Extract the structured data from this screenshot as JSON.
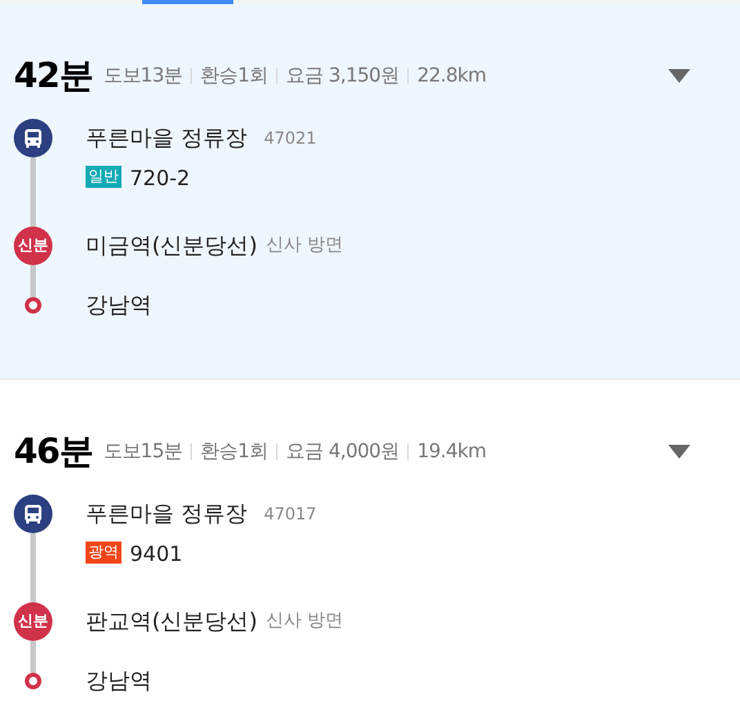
{
  "routes": [
    {
      "selected": true,
      "duration": "42분",
      "meta": [
        "도보13분",
        "환승1회",
        "요금 3,150원",
        "22.8km"
      ],
      "stops": [
        {
          "kind": "bus",
          "name": "푸른마을 정류장",
          "stop_id": "47021",
          "bus_type": "일반",
          "color": "#12aab5",
          "bus_number": "720-2"
        },
        {
          "kind": "subway",
          "badge": "신분",
          "name": "미금역(신분당선)",
          "direction": "신사 방면"
        },
        {
          "kind": "end",
          "name": "강남역"
        }
      ]
    },
    {
      "selected": false,
      "duration": "46분",
      "meta": [
        "도보15분",
        "환승1회",
        "요금 4,000원",
        "19.4km"
      ],
      "stops": [
        {
          "kind": "bus",
          "name": "푸른마을 정류장",
          "stop_id": "47017",
          "bus_type": "광역",
          "color": "#f2461a",
          "bus_number": "9401"
        },
        {
          "kind": "subway",
          "badge": "신분",
          "name": "판교역(신분당선)",
          "direction": "신사 방면"
        },
        {
          "kind": "end",
          "name": "강남역"
        }
      ]
    }
  ]
}
